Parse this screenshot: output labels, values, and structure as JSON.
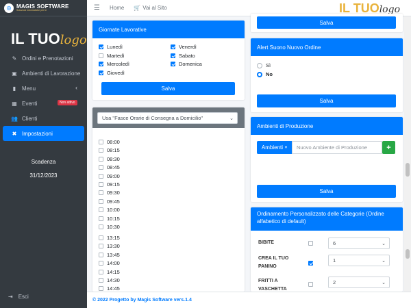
{
  "brand": {
    "name": "MAGIS SOFTWARE",
    "tagline": "Soluzioni informatiche per te"
  },
  "logo": {
    "part_a": "IL TUO",
    "part_b": "logo"
  },
  "sidebar": {
    "items": [
      {
        "label": "Ordini e Prenotazioni",
        "icon": "edit-icon"
      },
      {
        "label": "Ambienti di Lavorazione",
        "icon": "image-icon"
      },
      {
        "label": "Menu",
        "icon": "book-icon"
      },
      {
        "label": "Eventi",
        "icon": "calendar-icon",
        "badge": "Non attivo"
      },
      {
        "label": "Clienti",
        "icon": "users-icon"
      },
      {
        "label": "Impostazioni",
        "icon": "tools-icon"
      }
    ],
    "expiry_label": "Scadenza",
    "expiry_date": "31/12/2023",
    "logout": "Esci"
  },
  "topbar": {
    "home": "Home",
    "site": "Vai al Sito"
  },
  "giornate": {
    "title": "Giornate Lavorative",
    "days": [
      {
        "label": "Lunedì",
        "checked": true
      },
      {
        "label": "Venerdì",
        "checked": true
      },
      {
        "label": "Martedì",
        "checked": false
      },
      {
        "label": "Sabato",
        "checked": true
      },
      {
        "label": "Mercoledì",
        "checked": true
      },
      {
        "label": "Domenica",
        "checked": true
      },
      {
        "label": "Giovedì",
        "checked": true
      }
    ],
    "save": "Salva"
  },
  "fasce": {
    "select": "Usa \"Fasce Orarie di Consegna a Domicilio\"",
    "times_a": [
      "08:00",
      "08:15",
      "08:30",
      "08:45",
      "09:00",
      "09:15",
      "09:30",
      "09:45",
      "10:00",
      "10:15",
      "10:30"
    ],
    "times_b": [
      "13:15",
      "13:30",
      "13:45",
      "14:00",
      "14:15",
      "14:30",
      "14:45"
    ]
  },
  "top_save": "Salva",
  "alert": {
    "title": "Alert Suono Nuovo Ordine",
    "options": [
      {
        "label": "Sì",
        "selected": false
      },
      {
        "label": "No",
        "selected": true
      }
    ],
    "save": "Salva"
  },
  "produzione": {
    "title": "Ambienti di Produzione",
    "dropdown": "Ambienti",
    "placeholder": "Nuovo Ambiente di Produzione",
    "add": "+",
    "save": "Salva"
  },
  "ordinamento": {
    "title": "Ordinamento Personalizzato delle Categorie (Ordine alfabetico di default)",
    "rows": [
      {
        "name": "BIBITE",
        "checked": false,
        "value": "6"
      },
      {
        "name": "CREA IL TUO PANINO",
        "checked": true,
        "value": "1"
      },
      {
        "name": "FRITTI A VASCHETTA",
        "checked": false,
        "value": "2"
      }
    ]
  },
  "footer": {
    "prefix": "© 2022",
    "text": "Progetto by Magis Software vers.1.4"
  },
  "colors": {
    "primary": "#007bff",
    "sidebar": "#343a40",
    "danger": "#dc3545",
    "success": "#28a745",
    "logo_accent": "#e9b33c"
  }
}
